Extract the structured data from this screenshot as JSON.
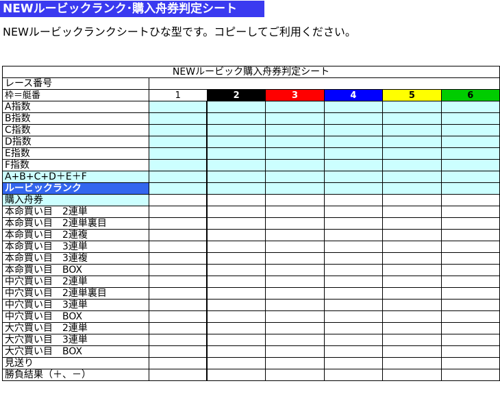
{
  "banner": {
    "title": "NEWルービックランク･購入舟券判定シート"
  },
  "subtitle": "NEWルービックランクシートひな型です。コピーしてご利用ください。",
  "sheet": {
    "title": "NEWルービック購入舟券判定シート",
    "race_label": "レース番号",
    "frame_label": "枠＝艇番",
    "lanes": [
      {
        "label": "1",
        "bg": "#ffffff",
        "fg": "#000000"
      },
      {
        "label": "2",
        "bg": "#000000",
        "fg": "#ffffff"
      },
      {
        "label": "3",
        "bg": "#ff0000",
        "fg": "#ffffff"
      },
      {
        "label": "4",
        "bg": "#0000ff",
        "fg": "#ffffff"
      },
      {
        "label": "5",
        "bg": "#ffff00",
        "fg": "#000000"
      },
      {
        "label": "6",
        "bg": "#00cc00",
        "fg": "#000000"
      }
    ],
    "index_rows": [
      "A指数",
      "B指数",
      "C指数",
      "D指数",
      "E指数",
      "F指数"
    ],
    "sum_row": "A+B+C+D＋E＋F",
    "rank_row": "ルービックランク",
    "ticket_row": "購入舟券",
    "bet_rows": [
      "本命買い目　2連単",
      "本命買い目　2連単裏目",
      "本命買い目　2連複",
      "本命買い目　3連単",
      "本命買い目　3連複",
      "本命買い目　BOX",
      "中穴買い目　2連単",
      "中穴買い目　2連単裏目",
      "中穴買い目　3連単",
      "中穴買い目　BOX",
      "大穴買い目　2連単",
      "大穴買い目　3連単",
      "大穴買い目　BOX"
    ],
    "skip_row": "見送り",
    "result_row": "勝負結果（＋、－）"
  }
}
